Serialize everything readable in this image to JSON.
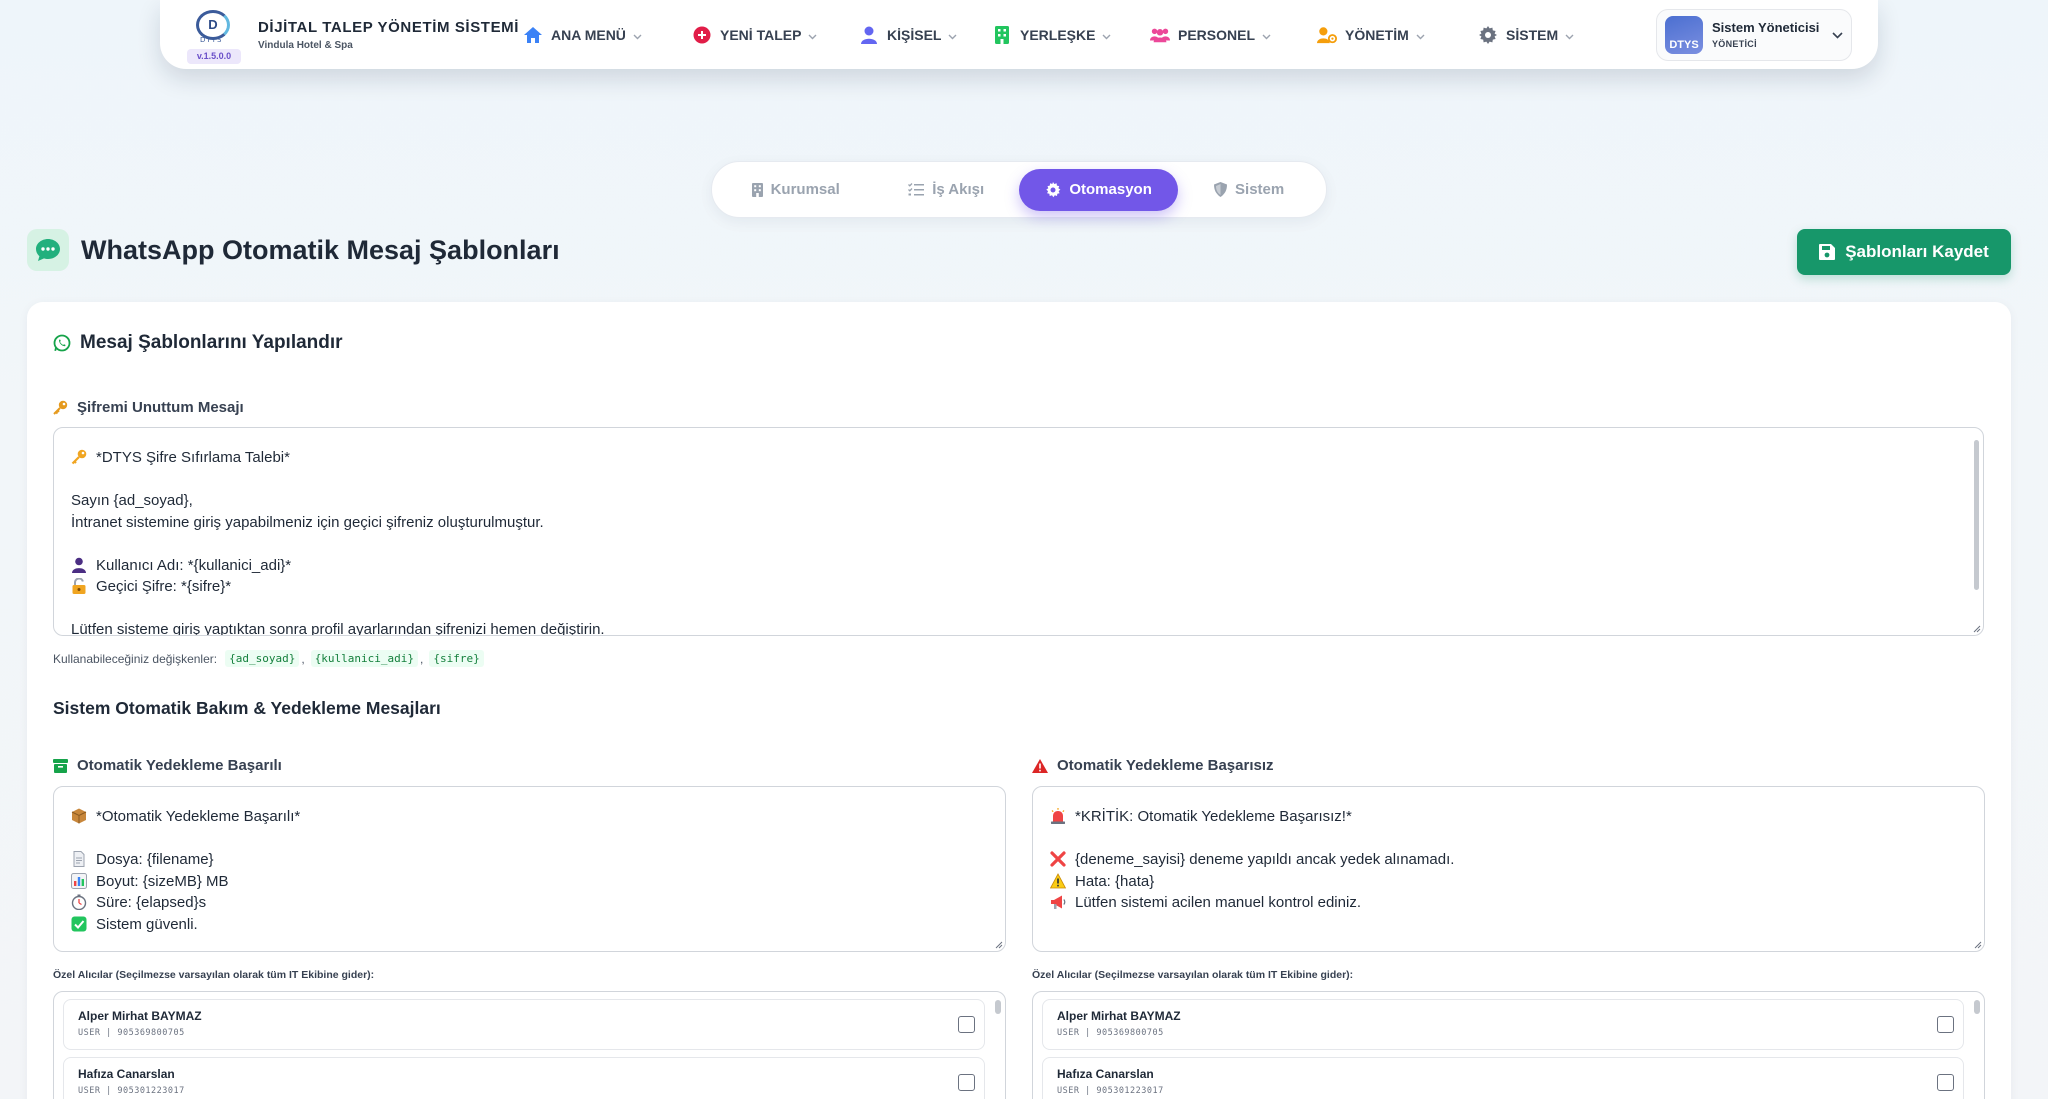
{
  "brand": {
    "logo_text": "D",
    "logo_sub": "DTYS",
    "version": "v.1.5.0.0",
    "title": "DİJİTAL TALEP YÖNETİM SİSTEMİ",
    "subtitle": "Vindula Hotel & Spa"
  },
  "nav": [
    {
      "label": "ANA MENÜ",
      "icon": "home-icon",
      "color": "#3b82f6"
    },
    {
      "label": "YENİ TALEP",
      "icon": "plus-circle-icon",
      "color": "#e11d48"
    },
    {
      "label": "KİŞİSEL",
      "icon": "user-icon",
      "color": "#6366f1"
    },
    {
      "label": "YERLEŞKE",
      "icon": "building-icon",
      "color": "#22c55e"
    },
    {
      "label": "PERSONEL",
      "icon": "users-icon",
      "color": "#ec4899"
    },
    {
      "label": "YÖNETİM",
      "icon": "user-gear-icon",
      "color": "#f59e0b"
    },
    {
      "label": "SİSTEM",
      "icon": "gear-icon",
      "color": "#6b7280"
    }
  ],
  "user": {
    "name": "Sistem Yöneticisi",
    "role": "YÖNETİCİ",
    "avatar_text": "DTYS"
  },
  "tabs": [
    {
      "label": "Kurumsal",
      "icon": "building-icon",
      "active": false
    },
    {
      "label": "İş Akışı",
      "icon": "list-check-icon",
      "active": false
    },
    {
      "label": "Otomasyon",
      "icon": "robot-icon",
      "active": true
    },
    {
      "label": "Sistem",
      "icon": "shield-icon",
      "active": false
    }
  ],
  "page": {
    "title": "WhatsApp Otomatik Mesaj Şablonları",
    "save_label": "Şablonları Kaydet"
  },
  "card": {
    "title": "Mesaj Şablonlarını Yapılandır",
    "forgot_password": {
      "label": "Şifremi Unuttum Mesajı",
      "lines": [
        {
          "emoji": "key-emoji",
          "text": "*DTYS Şifre Sıfırlama Talebi*"
        },
        {
          "emoji": "",
          "text": ""
        },
        {
          "emoji": "",
          "text": "Sayın {ad_soyad},"
        },
        {
          "emoji": "",
          "text": "İntranet sistemine giriş yapabilmeniz için geçici şifreniz oluşturulmuştur."
        },
        {
          "emoji": "",
          "text": ""
        },
        {
          "emoji": "person-emoji",
          "text": "Kullanıcı Adı: *{kullanici_adi}*"
        },
        {
          "emoji": "lock-emoji",
          "text": "Geçici Şifre: *{sifre}*"
        },
        {
          "emoji": "",
          "text": ""
        },
        {
          "emoji": "",
          "text": "Lütfen sisteme giriş yaptıktan sonra profil ayarlarından şifrenizi hemen değiştirin."
        }
      ],
      "vars_label": "Kullanabileceğiniz değişkenler:",
      "vars": [
        "{ad_soyad}",
        "{kullanici_adi}",
        "{sifre}"
      ]
    },
    "backup_section_title": "Sistem Otomatik Bakım & Yedekleme Mesajları",
    "backup_success": {
      "label": "Otomatik Yedekleme Başarılı",
      "lines": [
        {
          "emoji": "package-emoji",
          "text": "*Otomatik Yedekleme Başarılı*"
        },
        {
          "emoji": "",
          "text": ""
        },
        {
          "emoji": "file-emoji",
          "text": "Dosya: {filename}"
        },
        {
          "emoji": "chart-emoji",
          "text": "Boyut: {sizeMB} MB"
        },
        {
          "emoji": "stopwatch-emoji",
          "text": "Süre: {elapsed}s"
        },
        {
          "emoji": "check-emoji",
          "text": "Sistem güvenli."
        }
      ]
    },
    "backup_fail": {
      "label": "Otomatik Yedekleme Başarısız",
      "lines": [
        {
          "emoji": "siren-emoji",
          "text": "*KRİTİK: Otomatik Yedekleme Başarısız!*"
        },
        {
          "emoji": "",
          "text": ""
        },
        {
          "emoji": "cross-emoji",
          "text": "{deneme_sayisi} deneme yapıldı ancak yedek alınamadı."
        },
        {
          "emoji": "warning-emoji",
          "text": "Hata: {hata}"
        },
        {
          "emoji": "megaphone-emoji",
          "text": "Lütfen sistemi acilen manuel kontrol ediniz."
        }
      ]
    },
    "recipients_label": "Özel Alıcılar (Seçilmezse varsayılan olarak tüm IT Ekibine gider):",
    "recipients": [
      {
        "name": "Alper Mirhat BAYMAZ",
        "role": "USER",
        "phone": "905369800705"
      },
      {
        "name": "Hafıza Canarslan",
        "role": "USER",
        "phone": "905301223017"
      }
    ]
  }
}
